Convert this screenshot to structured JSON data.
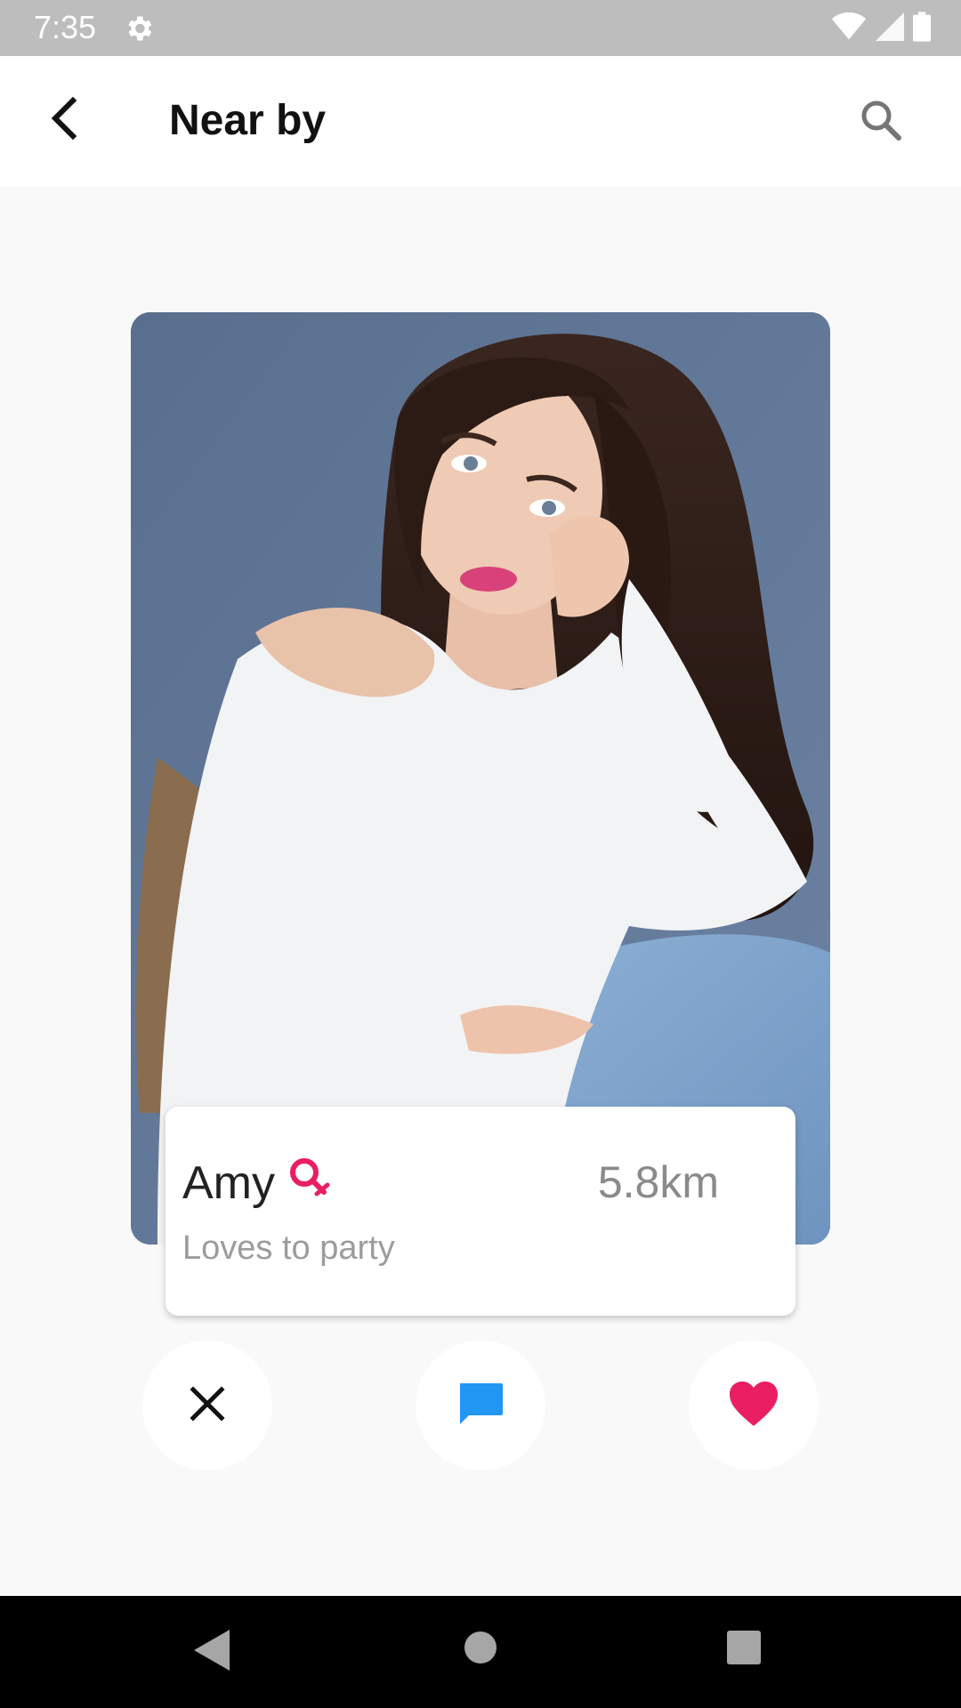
{
  "status_bar": {
    "time": "7:35",
    "icons": [
      "gear-icon",
      "wifi-icon",
      "signal-icon",
      "battery-icon"
    ]
  },
  "app_bar": {
    "title": "Near by",
    "back_icon": "chevron-left-icon",
    "search_icon": "search-icon"
  },
  "profile": {
    "name": "Amy",
    "gender_icon": "female-gender-icon",
    "distance": "5.8km",
    "tagline": "Loves to party"
  },
  "actions": [
    {
      "name": "dislike",
      "icon": "close-icon"
    },
    {
      "name": "chat",
      "icon": "chat-icon"
    },
    {
      "name": "like",
      "icon": "heart-icon"
    }
  ],
  "colors": {
    "accent_pink": "#e91e63",
    "chat_blue": "#2196f3",
    "status_bar": "#bdbdbd",
    "background": "#f9f9f9"
  },
  "nav_bar": {
    "icons": [
      "nav-back-icon",
      "nav-home-icon",
      "nav-recents-icon"
    ]
  }
}
